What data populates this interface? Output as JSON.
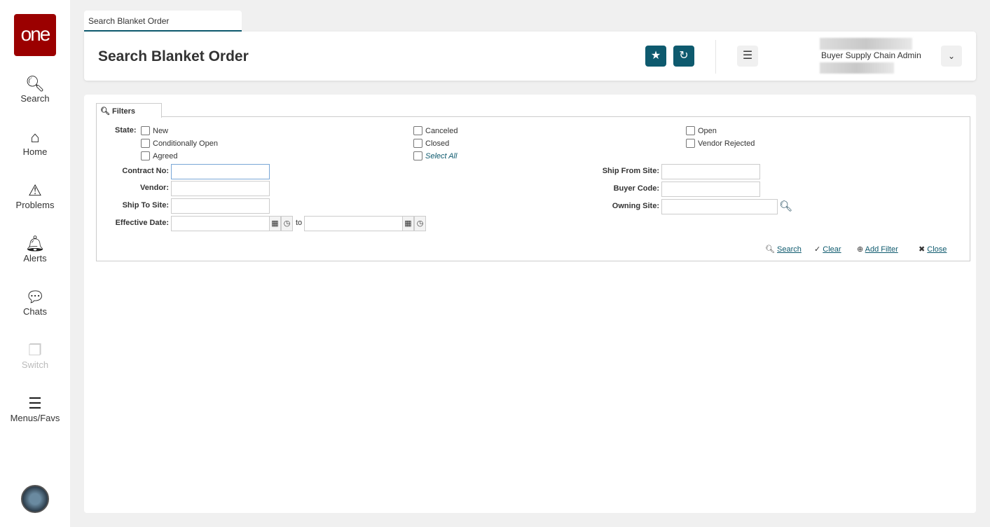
{
  "sidebar": {
    "logo": "one",
    "items": [
      {
        "label": "Search",
        "icon": "search-icon"
      },
      {
        "label": "Home",
        "icon": "home-icon"
      },
      {
        "label": "Problems",
        "icon": "warning-icon"
      },
      {
        "label": "Alerts",
        "icon": "bell-icon"
      },
      {
        "label": "Chats",
        "icon": "chat-icon"
      },
      {
        "label": "Switch",
        "icon": "switch-icon"
      },
      {
        "label": "Menus/Favs",
        "icon": "menu-icon"
      }
    ]
  },
  "tab": {
    "label": "Search Blanket Order"
  },
  "header": {
    "title": "Search Blanket Order",
    "role": "Buyer Supply Chain Admin"
  },
  "filters": {
    "tab_label": "Filters",
    "state_label": "State:",
    "states": [
      "New",
      "Conditionally Open",
      "Agreed",
      "Canceled",
      "Closed",
      "Select All",
      "Open",
      "Vendor Rejected"
    ],
    "fields": {
      "contract_no": "Contract No:",
      "vendor": "Vendor:",
      "ship_to_site": "Ship To Site:",
      "effective_date": "Effective Date:",
      "to": "to",
      "ship_from_site": "Ship From Site:",
      "buyer_code": "Buyer Code:",
      "owning_site": "Owning Site:"
    },
    "actions": {
      "search": "Search",
      "clear": "Clear",
      "add_filter": "Add Filter",
      "close": "Close"
    }
  }
}
